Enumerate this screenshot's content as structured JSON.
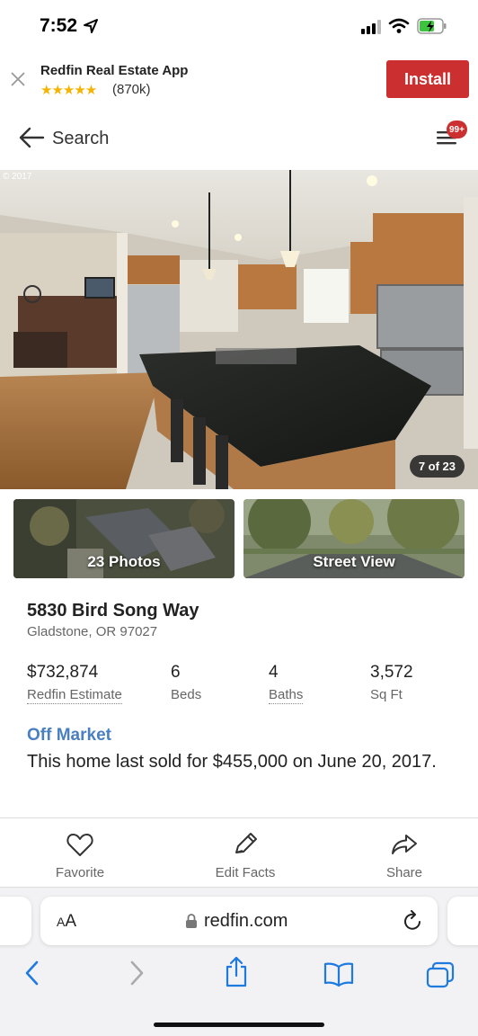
{
  "status_bar": {
    "time": "7:52"
  },
  "app_banner": {
    "title": "Redfin Real Estate App",
    "stars": "★★★★★",
    "rating_count": "(870k)",
    "install_label": "Install"
  },
  "nav": {
    "back_label": "Search",
    "menu_badge": "99+"
  },
  "hero": {
    "copyright": "© 2017",
    "photo_counter": "7 of 23"
  },
  "thumbnails": [
    {
      "label": "23 Photos"
    },
    {
      "label": "Street View"
    }
  ],
  "listing": {
    "address": "5830 Bird Song Way",
    "city": "Gladstone, OR 97027",
    "stats": [
      {
        "value": "$732,874",
        "label": "Redfin Estimate"
      },
      {
        "value": "6",
        "label": "Beds"
      },
      {
        "value": "4",
        "label": "Baths"
      },
      {
        "value": "3,572",
        "label": "Sq Ft"
      }
    ],
    "status": "Off Market",
    "sold_text": "This home last sold for $455,000 on June 20, 2017."
  },
  "actions": [
    {
      "label": "Favorite",
      "icon": "heart-icon"
    },
    {
      "label": "Edit Facts",
      "icon": "pencil-icon"
    },
    {
      "label": "Share",
      "icon": "share-icon"
    }
  ],
  "browser": {
    "aa_label_small": "A",
    "aa_label_large": "A",
    "url": "redfin.com"
  }
}
